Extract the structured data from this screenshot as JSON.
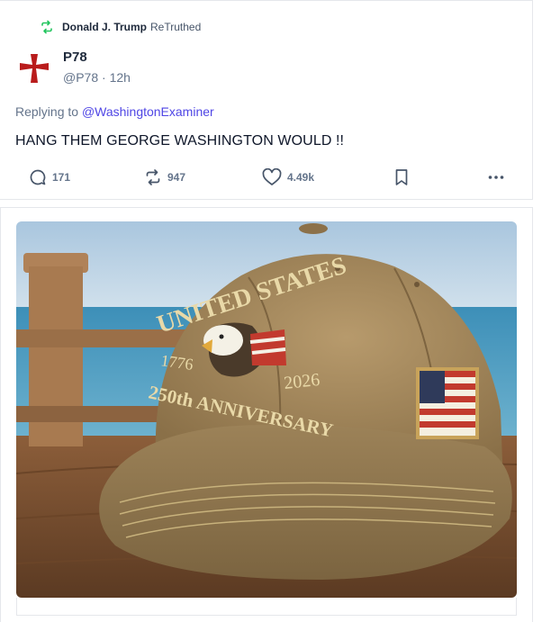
{
  "retruth": {
    "user": "Donald J. Trump",
    "label": "ReTruthed"
  },
  "post": {
    "username": "P78",
    "handle": "@P78",
    "time": "12h",
    "reply_prefix": "Replying to",
    "reply_to": "@WashingtonExaminer",
    "text": "HANG THEM GEORGE WASHINGTON WOULD !!"
  },
  "actions": {
    "replies": "171",
    "retruths": "947",
    "likes": "4.49k"
  },
  "image": {
    "cap_line1": "UNITED STATES",
    "year_left": "1776",
    "year_right": "2026",
    "cap_line2": "250th ANNIVERSARY"
  },
  "colors": {
    "accent": "#4f46e5",
    "retruth_green": "#22c55e",
    "avatar_red": "#b91c1c"
  }
}
